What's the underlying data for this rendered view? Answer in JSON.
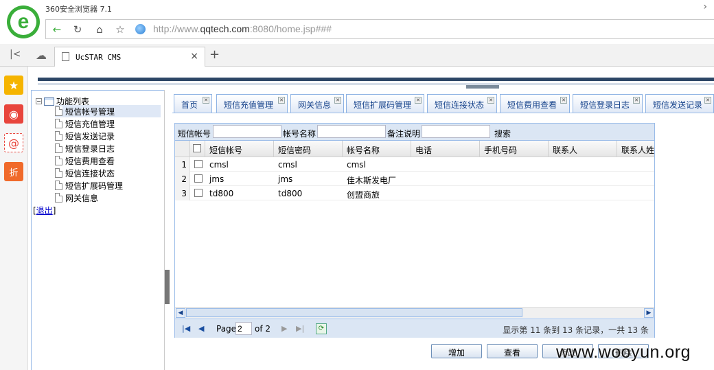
{
  "browser": {
    "window_title": "360安全浏览器 7.1",
    "url_prefix": "http://www.",
    "url_host": "qqtech.com",
    "url_rest": ":8080/home.jsp###",
    "tab_title": "UcSTAR CMS",
    "tab_close": "×",
    "new_tab": "+"
  },
  "tree": {
    "root_label": "功能列表",
    "items": [
      "短信帐号管理",
      "短信充值管理",
      "短信发送记录",
      "短信登录日志",
      "短信费用查看",
      "短信连接状态",
      "短信扩展码管理",
      "网关信息"
    ],
    "selected_index": 0,
    "logout_prefix": "[",
    "logout_label": "退出",
    "logout_suffix": "]"
  },
  "page_tabs": [
    "首页",
    "短信充值管理",
    "网关信息",
    "短信扩展码管理",
    "短信连接状态",
    "短信费用查看",
    "短信登录日志",
    "短信发送记录"
  ],
  "search": {
    "label_account": "短信帐号",
    "label_name": "帐号名称",
    "label_note": "备注说明",
    "button": "搜索"
  },
  "grid": {
    "columns": [
      "短信帐号",
      "短信密码",
      "帐号名称",
      "电话",
      "手机号码",
      "联系人",
      "联系人姓"
    ],
    "rows": [
      {
        "num": "1",
        "account": "cmsl",
        "password": "cmsl",
        "name": "cmsl",
        "phone": "",
        "mobile": "",
        "contact": ""
      },
      {
        "num": "2",
        "account": "jms",
        "password": "jms",
        "name": "佳木斯发电厂",
        "phone": "",
        "mobile": "",
        "contact": ""
      },
      {
        "num": "3",
        "account": "td800",
        "password": "td800",
        "name": "创盟商旅",
        "phone": "",
        "mobile": "",
        "contact": ""
      }
    ]
  },
  "pager": {
    "page_label": "Page",
    "page_value": "2",
    "of_label": "of 2",
    "info": "显示第 11 条到 13 条记录，一共 13 条"
  },
  "actions": {
    "add": "增加",
    "view": "查看",
    "edit": "修改",
    "delete": "删除"
  },
  "watermark": "www.wooyun.org",
  "colors": {
    "accent": "#15428b",
    "panel_border": "#99bbe8",
    "toolbar_bg": "#dbe6f4",
    "logo_green": "#3aae3a"
  }
}
